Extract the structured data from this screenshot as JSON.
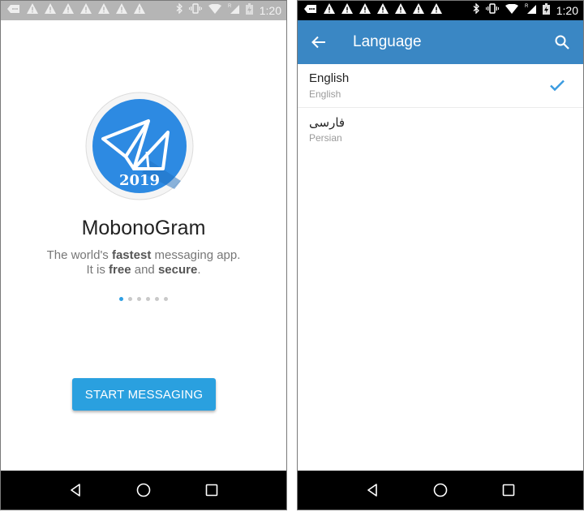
{
  "status_bar": {
    "time": "1:20",
    "notification_icons": [
      "message-icon",
      "warning-icon",
      "warning-icon",
      "warning-icon",
      "warning-icon",
      "warning-icon",
      "warning-icon",
      "warning-icon"
    ],
    "system_icons": [
      "bluetooth-icon",
      "vibrate-icon",
      "wifi-icon",
      "signal-icon",
      "battery-charging-icon"
    ],
    "roaming_label": "R"
  },
  "welcome_screen": {
    "logo_year": "2019",
    "app_name": "MobonoGram",
    "tagline_line1_pre": "The world's ",
    "tagline_line1_bold": "fastest",
    "tagline_line1_post": " messaging app.",
    "tagline_line2_pre": "It is ",
    "tagline_line2_bold1": "free",
    "tagline_line2_mid": " and ",
    "tagline_line2_bold2": "secure",
    "tagline_line2_post": ".",
    "page_indicator": {
      "total": 6,
      "active": 1
    },
    "start_button_label": "START MESSAGING"
  },
  "language_screen": {
    "title": "Language",
    "languages": [
      {
        "name": "English",
        "subtitle": "English",
        "selected": true
      },
      {
        "name": "فارسی",
        "subtitle": "Persian",
        "selected": false
      }
    ]
  },
  "colors": {
    "accent": "#2aa0df",
    "toolbar": "#3a87c4",
    "check": "#3a9be0"
  }
}
